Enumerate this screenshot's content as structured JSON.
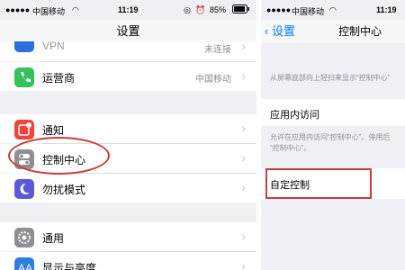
{
  "left": {
    "status": {
      "carrier": "中国移动",
      "time": "11:19",
      "battery": "85%"
    },
    "nav": {
      "title": "设置"
    },
    "vpn_row": {
      "label": "VPN",
      "value": "未连接"
    },
    "carrier_row": {
      "label": "运营商",
      "value": "中国移动"
    },
    "notify_row": {
      "label": "通知"
    },
    "control_row": {
      "label": "控制中心"
    },
    "dnd_row": {
      "label": "勿扰模式"
    },
    "general_row": {
      "label": "通用"
    },
    "display_row": {
      "label": "显示与亮度"
    }
  },
  "right": {
    "status": {
      "carrier": "中国移动",
      "time": "11:19"
    },
    "nav": {
      "back": "设置",
      "title": "控制中心"
    },
    "desc1": "从屏幕底部向上轻扫来显示“控制中心”",
    "app_access_label": "应用内访问",
    "desc2_line1": "允许在应用内访问“控制中心”。停用后",
    "desc2_line2": "“控制中心”。",
    "customize_label": "自定控制"
  },
  "colors": {
    "annotation": "#cc3b3b",
    "link": "#007aff"
  }
}
